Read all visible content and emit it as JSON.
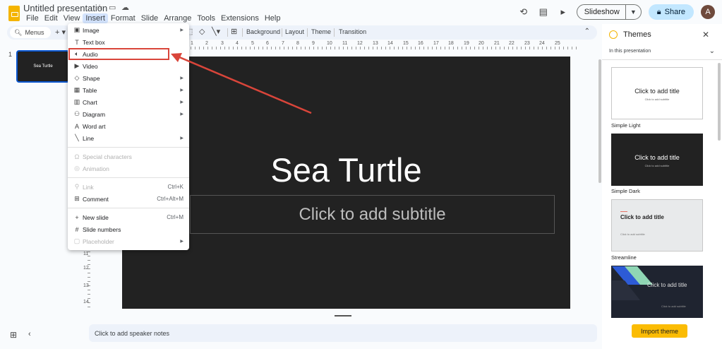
{
  "window": {
    "doc_title": "Untitled presentation",
    "menubar": [
      "File",
      "Edit",
      "View",
      "Insert",
      "Format",
      "Slide",
      "Arrange",
      "Tools",
      "Extensions",
      "Help"
    ],
    "slideshow_label": "Slideshow",
    "share_label": "Share",
    "avatar_initial": "A"
  },
  "toolbar": {
    "menus_label": "Menus",
    "background_label": "Background",
    "layout_label": "Layout",
    "theme_label": "Theme",
    "transition_label": "Transition"
  },
  "ruler": {
    "h_numbers": [
      "1",
      "2",
      "3",
      "4",
      "5",
      "6",
      "7",
      "8",
      "9",
      "10",
      "11",
      "12",
      "13",
      "14",
      "15",
      "16",
      "17",
      "18",
      "19",
      "20",
      "21",
      "22",
      "23",
      "24",
      "25"
    ],
    "v_numbers": [
      "11",
      "12",
      "13",
      "14"
    ]
  },
  "filmstrip": {
    "slide_number": "1",
    "thumb_text": "Sea Turtle"
  },
  "slide": {
    "title": "Sea Turtle",
    "subtitle_placeholder": "Click to add subtitle"
  },
  "speaker_notes": "Click to add speaker notes",
  "insert_menu": {
    "items": [
      {
        "label": "Image",
        "icon": "image-icon",
        "submenu": true,
        "disabled": false
      },
      {
        "label": "Text box",
        "icon": "textbox-icon",
        "submenu": false,
        "disabled": false
      },
      {
        "label": "Audio",
        "icon": "audio-icon",
        "submenu": false,
        "disabled": false,
        "highlighted": true
      },
      {
        "label": "Video",
        "icon": "video-icon",
        "submenu": false,
        "disabled": false
      },
      {
        "label": "Shape",
        "icon": "shape-icon",
        "submenu": true,
        "disabled": false
      },
      {
        "label": "Table",
        "icon": "table-icon",
        "submenu": true,
        "disabled": false
      },
      {
        "label": "Chart",
        "icon": "chart-icon",
        "submenu": true,
        "disabled": false
      },
      {
        "label": "Diagram",
        "icon": "diagram-icon",
        "submenu": true,
        "disabled": false
      },
      {
        "label": "Word art",
        "icon": "wordart-icon",
        "submenu": false,
        "disabled": false
      },
      {
        "label": "Line",
        "icon": "line-icon",
        "submenu": true,
        "disabled": false
      },
      {
        "label": "Special characters",
        "icon": "omega-icon",
        "submenu": false,
        "disabled": true
      },
      {
        "label": "Animation",
        "icon": "animation-icon",
        "submenu": false,
        "disabled": true
      },
      {
        "label": "Link",
        "icon": "link-icon",
        "shortcut": "Ctrl+K",
        "submenu": false,
        "disabled": true
      },
      {
        "label": "Comment",
        "icon": "comment-icon",
        "shortcut": "Ctrl+Alt+M",
        "submenu": false,
        "disabled": false
      },
      {
        "label": "New slide",
        "icon": "plus-icon",
        "shortcut": "Ctrl+M",
        "submenu": false,
        "disabled": false
      },
      {
        "label": "Slide numbers",
        "icon": "hash-icon",
        "submenu": false,
        "disabled": false
      },
      {
        "label": "Placeholder",
        "icon": "placeholder-icon",
        "submenu": true,
        "disabled": true
      }
    ]
  },
  "themes_panel": {
    "title": "Themes",
    "filter_label": "In this presentation",
    "themes": [
      {
        "name": "Simple Light",
        "card_title": "Click to add title",
        "card_subtitle": "Click to add subtitle"
      },
      {
        "name": "Simple Dark",
        "card_title": "Click to add title",
        "card_subtitle": "Click to add subtitle"
      },
      {
        "name": "Streamline",
        "card_title": "Click to add title",
        "card_subtitle": "Click to add subtitle"
      },
      {
        "name": "",
        "card_title": "Click to add title",
        "card_subtitle": "Click to add subtitle"
      }
    ],
    "import_label": "Import theme"
  },
  "colors": {
    "accent": "#0b57d0",
    "highlight_red": "#d9453a",
    "slide_bg": "#222222",
    "import_button": "#fbbc04"
  }
}
